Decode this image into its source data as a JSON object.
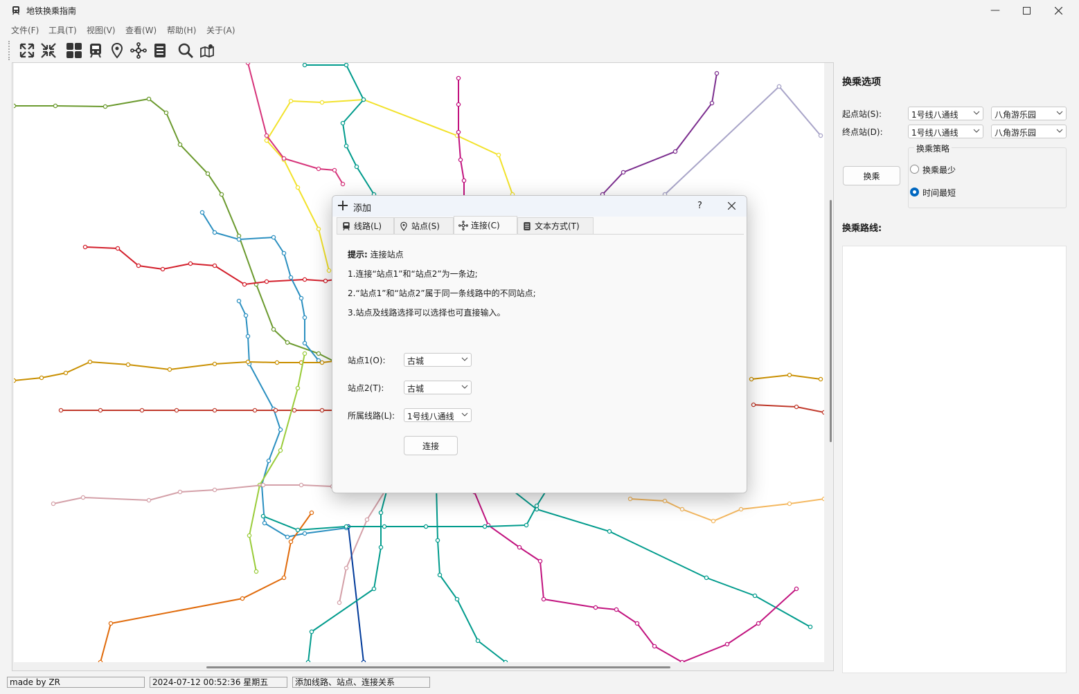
{
  "window": {
    "title": "地铁换乘指南"
  },
  "menu": [
    "文件(F)",
    "工具(T)",
    "视图(V)",
    "查看(W)",
    "帮助(H)",
    "关于(A)"
  ],
  "toolbar_icons": [
    "expand-icon",
    "collapse-icon",
    "grid-icon",
    "train-icon",
    "location-pin-icon",
    "network-icon",
    "document-list-icon",
    "search-icon",
    "map-icon"
  ],
  "sidebar": {
    "section_title": "换乘选项",
    "start_label": "起点站(S):",
    "end_label": "终点站(D):",
    "start_line": "1号线八通线",
    "start_station": "八角游乐园",
    "end_line": "1号线八通线",
    "end_station": "八角游乐园",
    "transfer_button": "换乘",
    "strategy_title": "换乘策略",
    "strategy_least": "换乘最少",
    "strategy_fastest": "时间最短",
    "selected_strategy": "时间最短",
    "route_label": "换乘路线:"
  },
  "dialog": {
    "title": "添加",
    "help": "?",
    "tabs": [
      {
        "label": "线路(L)",
        "icon": "train-icon",
        "active": false
      },
      {
        "label": "站点(S)",
        "icon": "location-pin-icon",
        "active": false
      },
      {
        "label": "连接(C)",
        "icon": "network-icon",
        "active": true
      },
      {
        "label": "文本方式(T)",
        "icon": "document-list-icon",
        "active": false
      }
    ],
    "hint_label": "提示:",
    "hint_title": "连接站点",
    "hint_1": "1.连接“站点1”和“站点2”为一条边;",
    "hint_2": "2.“站点1”和“站点2”属于同一条线路中的不同站点;",
    "hint_3": "3.站点及线路选择可以选择也可直接输入。",
    "station1_label": "站点1(O):",
    "station1_value": "古城",
    "station2_label": "站点2(T):",
    "station2_value": "古城",
    "line_label": "所属线路(L):",
    "line_value": "1号线八通线",
    "connect_button": "连接"
  },
  "status": {
    "author": "made by ZR",
    "datetime": "2024-07-12 00:52:36 星期五",
    "message": "添加线路、站点、连接关系"
  },
  "map": {
    "lines": [
      {
        "color": "#6b9a2e"
      },
      {
        "color": "#f2e22b"
      },
      {
        "color": "#009b8c"
      },
      {
        "color": "#c1127e"
      },
      {
        "color": "#7b2d8e"
      },
      {
        "color": "#a8a4c8"
      },
      {
        "color": "#d6337a"
      },
      {
        "color": "#d31f2b"
      },
      {
        "color": "#2a8fc0"
      },
      {
        "color": "#c98f00"
      },
      {
        "color": "#c0392b"
      },
      {
        "color": "#9acc3a"
      },
      {
        "color": "#e06a0a"
      },
      {
        "color": "#d4a0a8"
      },
      {
        "color": "#003a9a"
      },
      {
        "color": "#f4b860"
      }
    ]
  }
}
